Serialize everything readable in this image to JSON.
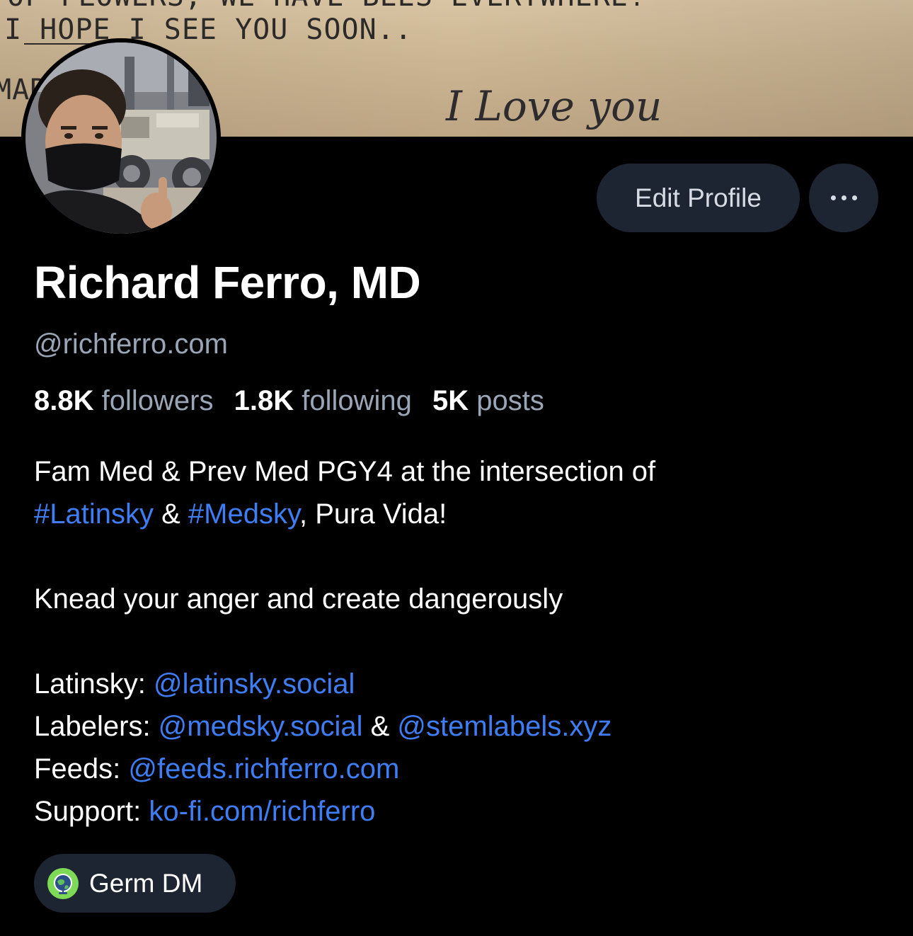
{
  "banner": {
    "typed_line_1": "OF FLOWERS, WE HAVE  BEES EVERYWHERE!",
    "typed_line_2": "I HOPE I SEE YOU SOON..",
    "typed_line_3": "MARK.",
    "handwriting": "I Love you"
  },
  "profile": {
    "display_name": "Richard Ferro, MD",
    "handle": "@richferro.com"
  },
  "actions": {
    "edit_profile_label": "Edit Profile",
    "more_icon": "ellipsis-icon"
  },
  "stats": {
    "followers_count": "8.8K",
    "followers_label": "followers",
    "following_count": "1.8K",
    "following_label": "following",
    "posts_count": "5K",
    "posts_label": "posts"
  },
  "bio": {
    "line1": "Fam Med & Prev Med PGY4 at the intersection of",
    "hashtag_latinsky": "#Latinsky",
    "amp1": " & ",
    "hashtag_medsky": "#Medsky",
    "line2_rest": ", Pura Vida!",
    "motto": "Knead your anger and create dangerously",
    "latinsky_label": "Latinsky: ",
    "latinsky_link": "@latinsky.social",
    "labelers_label": "Labelers: ",
    "labelers_link_1": "@medsky.social",
    "labelers_amp": " & ",
    "labelers_link_2": "@stemlabels.xyz",
    "feeds_label": "Feeds: ",
    "feeds_link": "@feeds.richferro.com",
    "support_label": "Support: ",
    "support_link": "ko-fi.com/richferro"
  },
  "germ": {
    "label": "Germ DM",
    "icon": "germ-globe-icon"
  },
  "colors": {
    "background": "#000000",
    "button_bg": "#1e2532",
    "muted_text": "#9aa5b6",
    "link": "#3f7df4",
    "germ_green": "#7ed957"
  }
}
